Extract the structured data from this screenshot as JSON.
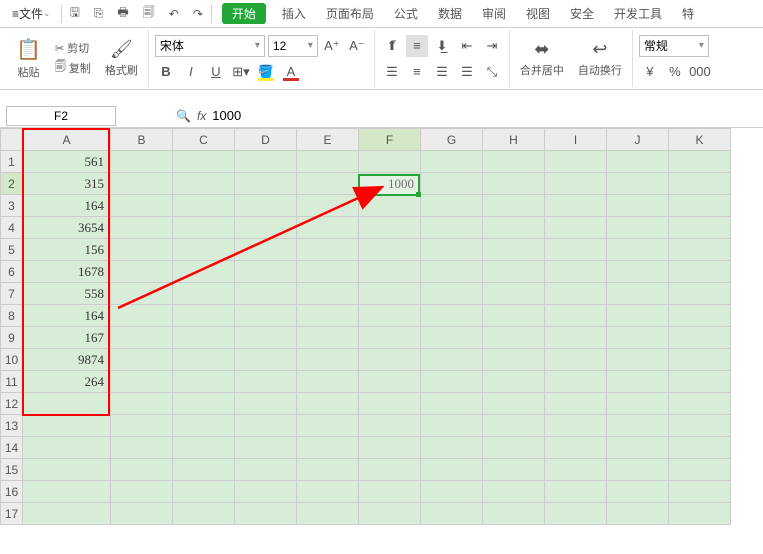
{
  "menubar": {
    "file": "文件",
    "tabs": {
      "start": "开始",
      "insert": "插入",
      "layout": "页面布局",
      "formula": "公式",
      "data": "数据",
      "review": "审阅",
      "view": "视图",
      "security": "安全",
      "dev": "开发工具",
      "special": "特"
    }
  },
  "ribbon": {
    "paste": "粘贴",
    "cut": "剪切",
    "copy": "复制",
    "format_painter": "格式刷",
    "font_name": "宋体",
    "font_size": "12",
    "merge_center": "合并居中",
    "wrap": "自动换行",
    "number_format": "常规"
  },
  "namebox": {
    "cell_ref": "F2",
    "formula": "1000"
  },
  "columns": [
    "A",
    "B",
    "C",
    "D",
    "E",
    "F",
    "G",
    "H",
    "I",
    "J",
    "K"
  ],
  "rows": [
    "1",
    "2",
    "3",
    "4",
    "5",
    "6",
    "7",
    "8",
    "9",
    "10",
    "11",
    "12",
    "13",
    "14",
    "15",
    "16",
    "17"
  ],
  "data_A": [
    "561",
    "315",
    "164",
    "3654",
    "156",
    "1678",
    "558",
    "164",
    "167",
    "9874",
    "264"
  ],
  "data_F2": "1000",
  "chart_data": {
    "type": "table",
    "note": "Spreadsheet column A values and single reference cell F2",
    "columnA": [
      561,
      315,
      164,
      3654,
      156,
      1678,
      558,
      164,
      167,
      9874,
      264
    ],
    "F2": 1000
  }
}
